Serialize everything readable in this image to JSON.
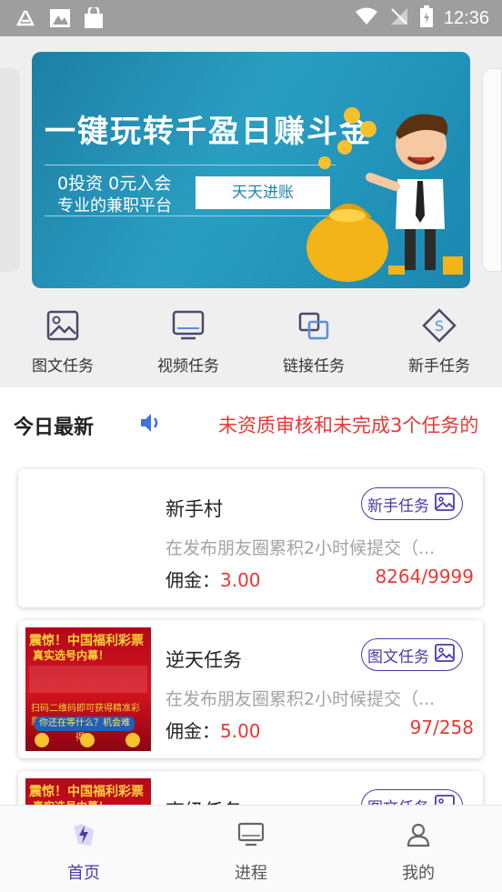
{
  "status_bar": {
    "time": "12:36"
  },
  "banner": {
    "title": "一键玩转千盈日赚斗金",
    "subtitle_line1": "0投资  0元入会",
    "subtitle_line2": "专业的兼职平台",
    "cta": "天天进账"
  },
  "categories": [
    {
      "label": "图文任务",
      "icon": "image-icon"
    },
    {
      "label": "视频任务",
      "icon": "monitor-icon"
    },
    {
      "label": "链接任务",
      "icon": "link-icon"
    },
    {
      "label": "新手任务",
      "icon": "diamond-s-icon"
    }
  ],
  "news": {
    "heading": "今日最新",
    "ticker": "未资质审核和未完成3个任务的"
  },
  "tasks": [
    {
      "name": "新手村",
      "tag": "新手任务",
      "desc": "在发布朋友圈累积2小时候提交（...",
      "fee_label": "佣金：",
      "fee": "3.00",
      "count": "8264/9999"
    },
    {
      "name": "逆天任务",
      "tag": "图文任务",
      "desc": "在发布朋友圈累积2小时候提交（...",
      "fee_label": "佣金：",
      "fee": "5.00",
      "count": "97/258"
    },
    {
      "name": "高级任务",
      "tag": "图文任务"
    }
  ],
  "poster": {
    "title": "震惊！中国福利彩票",
    "subtitle": "真实选号内幕！",
    "line": "扫码二维码即可获得精准彩票计划",
    "button": "你还在等什么？机会难得！"
  },
  "bottom_nav": [
    {
      "label": "首页",
      "active": true
    },
    {
      "label": "进程",
      "active": false
    },
    {
      "label": "我的",
      "active": false
    }
  ],
  "colors": {
    "accent": "#4a3aa8",
    "price": "#e53935",
    "banner": "#1f8fb7"
  }
}
